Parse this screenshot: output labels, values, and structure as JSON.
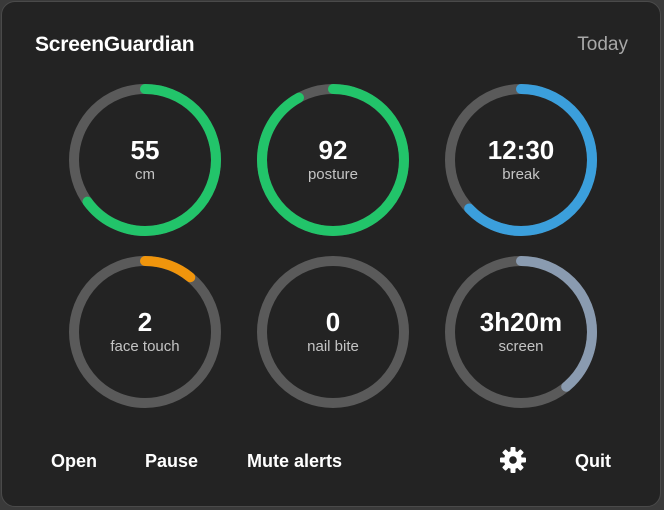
{
  "header": {
    "title": "ScreenGuardian",
    "period": "Today"
  },
  "colors": {
    "track": "#5a5a5a",
    "green": "#22c46a",
    "blue": "#3b9fdc",
    "orange": "#f0950c",
    "slate": "#8a9bb0"
  },
  "metrics": [
    {
      "value": "55",
      "label": "cm",
      "progress": 0.65,
      "color": "#22c46a"
    },
    {
      "value": "92",
      "label": "posture",
      "progress": 0.92,
      "color": "#22c46a"
    },
    {
      "value": "12:30",
      "label": "break",
      "progress": 0.63,
      "color": "#3b9fdc"
    },
    {
      "value": "2",
      "label": "face touch",
      "progress": 0.11,
      "color": "#f0950c"
    },
    {
      "value": "0",
      "label": "nail bite",
      "progress": 0,
      "color": "#8a9bb0"
    },
    {
      "value": "3h20m",
      "label": "screen",
      "progress": 0.39,
      "color": "#8a9bb0"
    }
  ],
  "footer": {
    "open_label": "Open",
    "pause_label": "Pause",
    "mute_label": "Mute alerts",
    "settings_icon": "gear-icon",
    "quit_label": "Quit"
  }
}
